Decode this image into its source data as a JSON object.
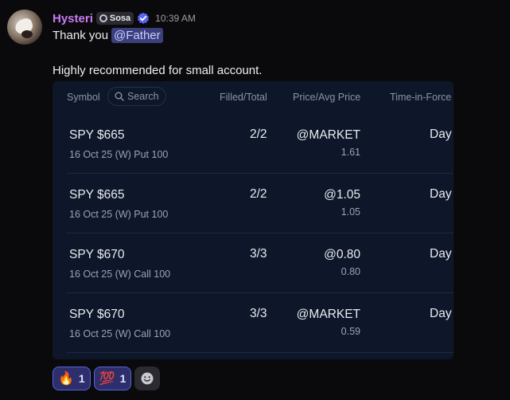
{
  "message": {
    "username": "Hysteri",
    "role_tag": "Sosa",
    "timestamp": "10:39 AM",
    "line1_prefix": "Thank you",
    "mention": "@Father",
    "line2": "Highly recommended for small account."
  },
  "table": {
    "headers": {
      "symbol": "Symbol",
      "search_placeholder": "Search",
      "filled_total": "Filled/Total",
      "price_avg": "Price/Avg Price",
      "time_in_force": "Time-in-Force"
    },
    "rows": [
      {
        "symbol": "SPY $665",
        "description": "16 Oct 25 (W) Put 100",
        "filled": "2/2",
        "price": "@MARKET",
        "avg": "1.61",
        "tif": "Day"
      },
      {
        "symbol": "SPY $665",
        "description": "16 Oct 25 (W) Put 100",
        "filled": "2/2",
        "price": "@1.05",
        "avg": "1.05",
        "tif": "Day"
      },
      {
        "symbol": "SPY $670",
        "description": "16 Oct 25 (W) Call 100",
        "filled": "3/3",
        "price": "@0.80",
        "avg": "0.80",
        "tif": "Day"
      },
      {
        "symbol": "SPY $670",
        "description": "16 Oct 25 (W) Call 100",
        "filled": "3/3",
        "price": "@MARKET",
        "avg": "0.59",
        "tif": "Day"
      }
    ]
  },
  "reactions": [
    {
      "emoji": "🔥",
      "icon": "fire-emoji",
      "count": "1"
    },
    {
      "emoji": "💯",
      "icon": "hundred-points-emoji",
      "count": "1"
    }
  ],
  "colors": {
    "username": "#c97cf2",
    "mention_bg": "#3b3f7d",
    "card_bg": "#0e1729",
    "reaction_border": "#5a61d6"
  }
}
